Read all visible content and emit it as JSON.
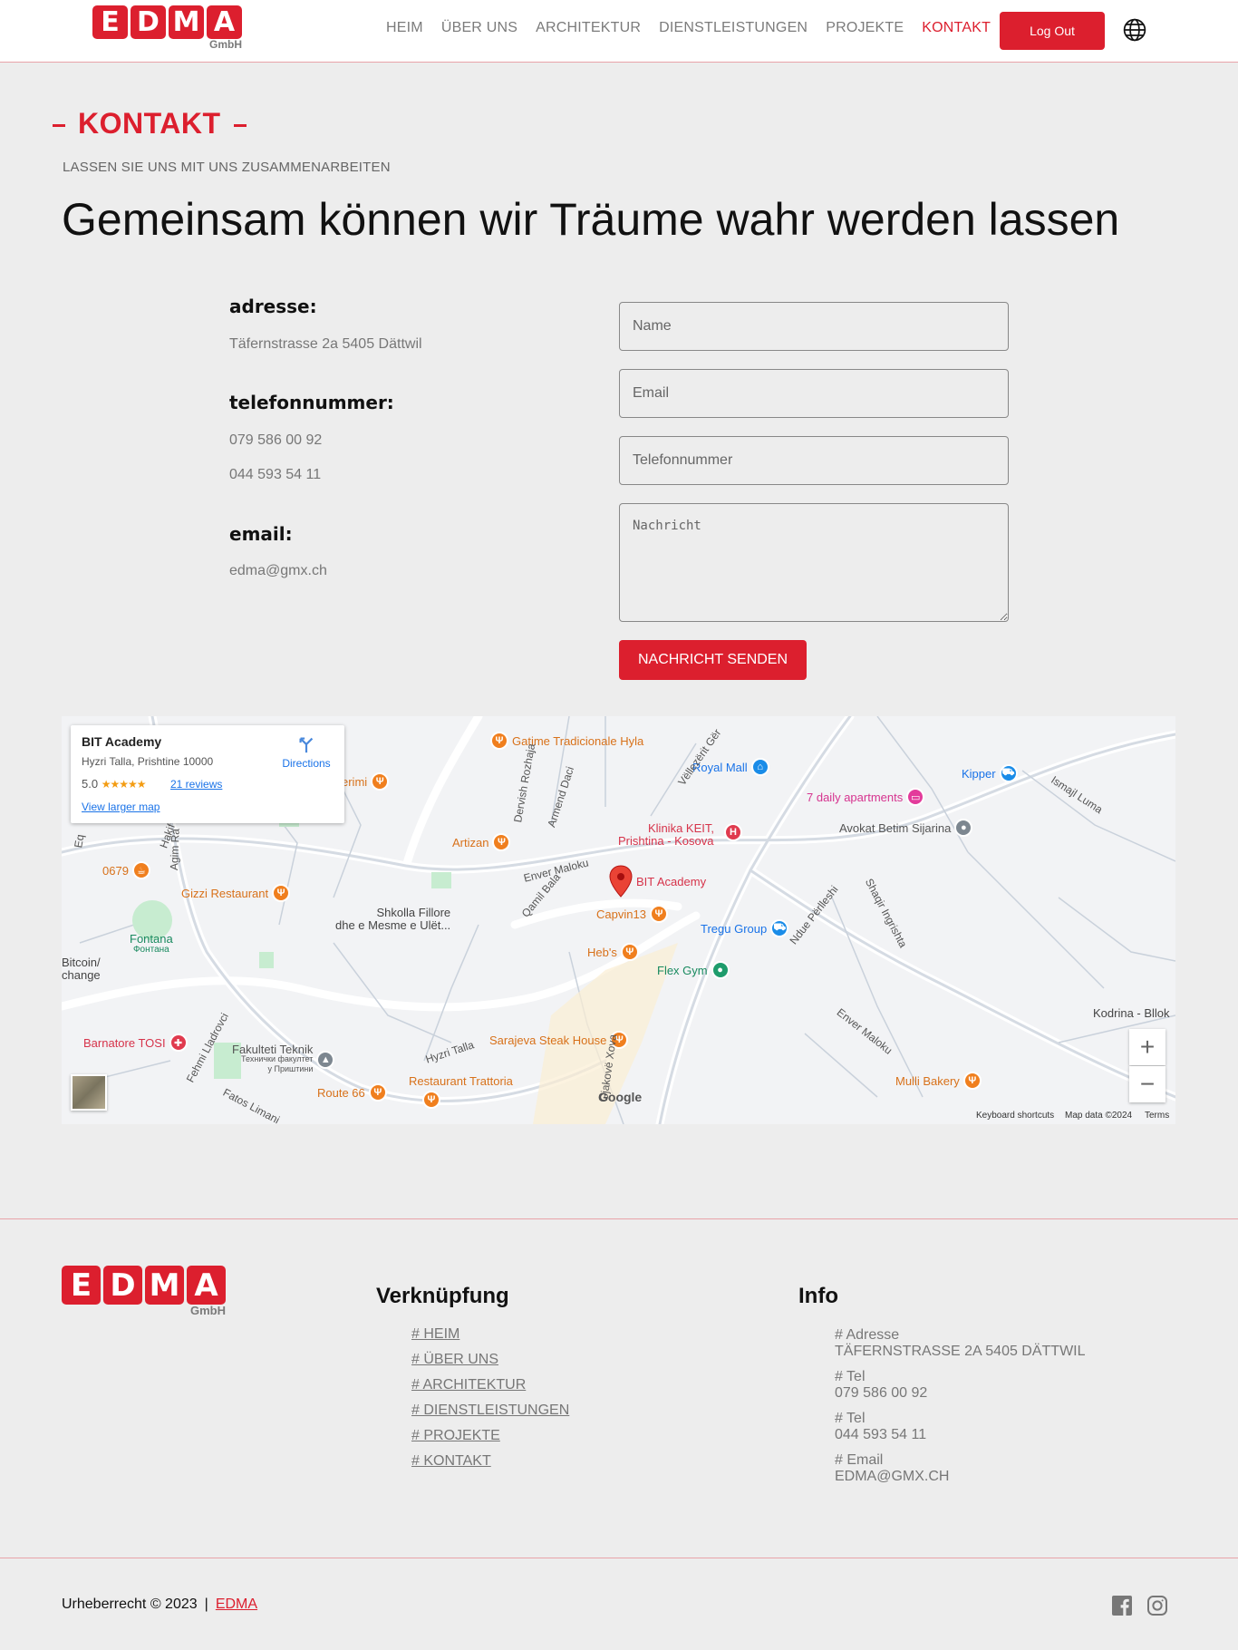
{
  "header": {
    "logo": {
      "letters": [
        "E",
        "D",
        "M",
        "A"
      ],
      "sub": "GmbH"
    },
    "nav": [
      {
        "label": "HEIM",
        "active": false
      },
      {
        "label": "ÜBER UNS",
        "active": false
      },
      {
        "label": "ARCHITEKTUR",
        "active": false
      },
      {
        "label": "DIENSTLEISTUNGEN",
        "active": false
      },
      {
        "label": "PROJEKTE",
        "active": false
      },
      {
        "label": "KONTAKT",
        "active": true
      }
    ],
    "logout_label": "Log Out",
    "globe_icon": "globe-icon"
  },
  "contact": {
    "section_title": "KONTAKT",
    "subtitle": "LASSEN SIE UNS MIT UNS ZUSAMMENARBEITEN",
    "headline": "Gemeinsam können wir Träume wahr werden lassen",
    "address_label": "adresse:",
    "address": "Täfernstrasse 2a 5405 Dättwil",
    "phone_label": "telefonnummer:",
    "phone1": "079 586 00 92",
    "phone2": "044 593 54 11",
    "email_label": "email:",
    "email": "edma@gmx.ch"
  },
  "form": {
    "name_placeholder": "Name",
    "email_placeholder": "Email",
    "phone_placeholder": "Telefonnummer",
    "message_placeholder": "Nachricht",
    "submit_label": "NACHRICHT SENDEN"
  },
  "map": {
    "card": {
      "title": "BIT Academy",
      "address": "Hyzri Talla, Prishtine 10000",
      "rating": "5.0",
      "stars": "★★★★★",
      "reviews": "21 reviews",
      "directions": "Directions",
      "larger_map": "View larger map"
    },
    "pois": [
      {
        "label": "Gatime Tradicionale Hyla",
        "kind": "food"
      },
      {
        "label": "Royal Mall",
        "kind": "shop"
      },
      {
        "label": "Kipper",
        "kind": "shop"
      },
      {
        "label": "7 daily apartments",
        "kind": "pink"
      },
      {
        "label": "Avokat Betim Sijarina",
        "kind": "grey"
      },
      {
        "label": "erimi",
        "kind": "food"
      },
      {
        "label": "Artizan",
        "kind": "food"
      },
      {
        "label": "Klinika KEIT,",
        "kind": "red"
      },
      {
        "label": "Prishtina - Kosova",
        "kind": "red"
      },
      {
        "label": "BIT Academy",
        "kind": "red"
      },
      {
        "label": "0679",
        "kind": "food"
      },
      {
        "label": "Gizzi Restaurant",
        "kind": "food"
      },
      {
        "label": "Shkolla Fillore",
        "kind": "place"
      },
      {
        "label": "dhe e Mesme e Ulët...",
        "kind": "place"
      },
      {
        "label": "Fontana",
        "kind": "green"
      },
      {
        "label": "Фонтана",
        "kind": "green"
      },
      {
        "label": "Capvin13",
        "kind": "food"
      },
      {
        "label": "Tregu Group",
        "kind": "shop"
      },
      {
        "label": "Bitcoin/",
        "kind": "place"
      },
      {
        "label": "change",
        "kind": "place"
      },
      {
        "label": "Heb's",
        "kind": "food"
      },
      {
        "label": "Flex Gym",
        "kind": "green"
      },
      {
        "label": "Kodrina - Bllok",
        "kind": "place"
      },
      {
        "label": "Barnatore TOSI",
        "kind": "red"
      },
      {
        "label": "Sarajeva Steak House",
        "kind": "food"
      },
      {
        "label": "Fakulteti Teknik",
        "kind": "grey"
      },
      {
        "label": "Технички факултет",
        "kind": "grey"
      },
      {
        "label": "у Приштини",
        "kind": "grey"
      },
      {
        "label": "Restaurant Trattoria",
        "kind": "food"
      },
      {
        "label": "Route 66",
        "kind": "food"
      },
      {
        "label": "Mulli Bakery",
        "kind": "food"
      }
    ],
    "streets": [
      "Enver Maloku",
      "Ndue Përlleshi",
      "Shaqir Ingrishta",
      "Ismajl Luma",
      "Vëllezërit Gër",
      "Dervish Rozhaja",
      "Armend Daci",
      "Qamil Bala",
      "Agim Ra",
      "Hakif",
      "Hyzri Talla",
      "Fehmi Lladrovci",
      "Fatos Limani",
      "Gjakovë Xova",
      "Enver Maloku",
      "Eq"
    ],
    "google": "Google",
    "keyboard_shortcuts": "Keyboard shortcuts",
    "map_data": "Map data ©2024",
    "terms": "Terms",
    "zoom_in": "+",
    "zoom_out": "−"
  },
  "footer": {
    "logo": {
      "letters": [
        "E",
        "D",
        "M",
        "A"
      ],
      "sub": "GmbH"
    },
    "links_title": "Verknüpfung",
    "links": [
      "# HEIM",
      "# ÜBER UNS",
      "# ARCHITEKTUR",
      "# DIENSTLEISTUNGEN",
      "# PROJEKTE",
      "# KONTAKT"
    ],
    "info_title": "Info",
    "info": [
      {
        "label": "# Adresse",
        "value": "TÄFERNSTRASSE 2A 5405 DÄTTWIL"
      },
      {
        "label": "# Tel",
        "value": "079 586 00 92"
      },
      {
        "label": "# Tel",
        "value": "044 593 54 11"
      },
      {
        "label": "# Email",
        "value": "EDMA@GMX.CH"
      }
    ],
    "copyright": "Urheberrecht © 2023",
    "separator": "|",
    "brand": "EDMA",
    "social": [
      "facebook-icon",
      "instagram-icon"
    ]
  },
  "colors": {
    "accent": "#dc1f2e",
    "background": "#ededed",
    "muted_text": "#777777"
  }
}
